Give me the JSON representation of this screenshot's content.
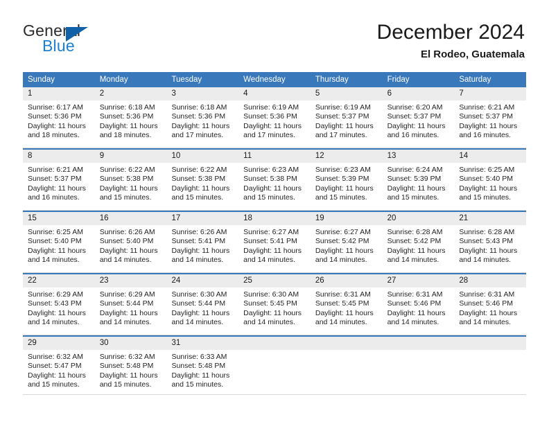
{
  "brand": {
    "word_general": "General",
    "word_blue": "Blue",
    "flag_icon": "brand-flag-icon",
    "accent_color": "#1b7fd4",
    "flag_color": "#1161a8"
  },
  "header": {
    "title": "December 2024",
    "subtitle": "El Rodeo, Guatemala"
  },
  "theme": {
    "header_bar_color": "#3a78bc",
    "daynum_band_color": "#ececec",
    "cell_border_color": "#d8d8d8",
    "text_color": "#1a1a1a"
  },
  "weekdays": [
    "Sunday",
    "Monday",
    "Tuesday",
    "Wednesday",
    "Thursday",
    "Friday",
    "Saturday"
  ],
  "weeks": [
    [
      {
        "day": "1",
        "sunrise": "Sunrise: 6:17 AM",
        "sunset": "Sunset: 5:36 PM",
        "daylight_line1": "Daylight: 11 hours",
        "daylight_line2": "and 18 minutes."
      },
      {
        "day": "2",
        "sunrise": "Sunrise: 6:18 AM",
        "sunset": "Sunset: 5:36 PM",
        "daylight_line1": "Daylight: 11 hours",
        "daylight_line2": "and 18 minutes."
      },
      {
        "day": "3",
        "sunrise": "Sunrise: 6:18 AM",
        "sunset": "Sunset: 5:36 PM",
        "daylight_line1": "Daylight: 11 hours",
        "daylight_line2": "and 17 minutes."
      },
      {
        "day": "4",
        "sunrise": "Sunrise: 6:19 AM",
        "sunset": "Sunset: 5:36 PM",
        "daylight_line1": "Daylight: 11 hours",
        "daylight_line2": "and 17 minutes."
      },
      {
        "day": "5",
        "sunrise": "Sunrise: 6:19 AM",
        "sunset": "Sunset: 5:37 PM",
        "daylight_line1": "Daylight: 11 hours",
        "daylight_line2": "and 17 minutes."
      },
      {
        "day": "6",
        "sunrise": "Sunrise: 6:20 AM",
        "sunset": "Sunset: 5:37 PM",
        "daylight_line1": "Daylight: 11 hours",
        "daylight_line2": "and 16 minutes."
      },
      {
        "day": "7",
        "sunrise": "Sunrise: 6:21 AM",
        "sunset": "Sunset: 5:37 PM",
        "daylight_line1": "Daylight: 11 hours",
        "daylight_line2": "and 16 minutes."
      }
    ],
    [
      {
        "day": "8",
        "sunrise": "Sunrise: 6:21 AM",
        "sunset": "Sunset: 5:37 PM",
        "daylight_line1": "Daylight: 11 hours",
        "daylight_line2": "and 16 minutes."
      },
      {
        "day": "9",
        "sunrise": "Sunrise: 6:22 AM",
        "sunset": "Sunset: 5:38 PM",
        "daylight_line1": "Daylight: 11 hours",
        "daylight_line2": "and 15 minutes."
      },
      {
        "day": "10",
        "sunrise": "Sunrise: 6:22 AM",
        "sunset": "Sunset: 5:38 PM",
        "daylight_line1": "Daylight: 11 hours",
        "daylight_line2": "and 15 minutes."
      },
      {
        "day": "11",
        "sunrise": "Sunrise: 6:23 AM",
        "sunset": "Sunset: 5:38 PM",
        "daylight_line1": "Daylight: 11 hours",
        "daylight_line2": "and 15 minutes."
      },
      {
        "day": "12",
        "sunrise": "Sunrise: 6:23 AM",
        "sunset": "Sunset: 5:39 PM",
        "daylight_line1": "Daylight: 11 hours",
        "daylight_line2": "and 15 minutes."
      },
      {
        "day": "13",
        "sunrise": "Sunrise: 6:24 AM",
        "sunset": "Sunset: 5:39 PM",
        "daylight_line1": "Daylight: 11 hours",
        "daylight_line2": "and 15 minutes."
      },
      {
        "day": "14",
        "sunrise": "Sunrise: 6:25 AM",
        "sunset": "Sunset: 5:40 PM",
        "daylight_line1": "Daylight: 11 hours",
        "daylight_line2": "and 15 minutes."
      }
    ],
    [
      {
        "day": "15",
        "sunrise": "Sunrise: 6:25 AM",
        "sunset": "Sunset: 5:40 PM",
        "daylight_line1": "Daylight: 11 hours",
        "daylight_line2": "and 14 minutes."
      },
      {
        "day": "16",
        "sunrise": "Sunrise: 6:26 AM",
        "sunset": "Sunset: 5:40 PM",
        "daylight_line1": "Daylight: 11 hours",
        "daylight_line2": "and 14 minutes."
      },
      {
        "day": "17",
        "sunrise": "Sunrise: 6:26 AM",
        "sunset": "Sunset: 5:41 PM",
        "daylight_line1": "Daylight: 11 hours",
        "daylight_line2": "and 14 minutes."
      },
      {
        "day": "18",
        "sunrise": "Sunrise: 6:27 AM",
        "sunset": "Sunset: 5:41 PM",
        "daylight_line1": "Daylight: 11 hours",
        "daylight_line2": "and 14 minutes."
      },
      {
        "day": "19",
        "sunrise": "Sunrise: 6:27 AM",
        "sunset": "Sunset: 5:42 PM",
        "daylight_line1": "Daylight: 11 hours",
        "daylight_line2": "and 14 minutes."
      },
      {
        "day": "20",
        "sunrise": "Sunrise: 6:28 AM",
        "sunset": "Sunset: 5:42 PM",
        "daylight_line1": "Daylight: 11 hours",
        "daylight_line2": "and 14 minutes."
      },
      {
        "day": "21",
        "sunrise": "Sunrise: 6:28 AM",
        "sunset": "Sunset: 5:43 PM",
        "daylight_line1": "Daylight: 11 hours",
        "daylight_line2": "and 14 minutes."
      }
    ],
    [
      {
        "day": "22",
        "sunrise": "Sunrise: 6:29 AM",
        "sunset": "Sunset: 5:43 PM",
        "daylight_line1": "Daylight: 11 hours",
        "daylight_line2": "and 14 minutes."
      },
      {
        "day": "23",
        "sunrise": "Sunrise: 6:29 AM",
        "sunset": "Sunset: 5:44 PM",
        "daylight_line1": "Daylight: 11 hours",
        "daylight_line2": "and 14 minutes."
      },
      {
        "day": "24",
        "sunrise": "Sunrise: 6:30 AM",
        "sunset": "Sunset: 5:44 PM",
        "daylight_line1": "Daylight: 11 hours",
        "daylight_line2": "and 14 minutes."
      },
      {
        "day": "25",
        "sunrise": "Sunrise: 6:30 AM",
        "sunset": "Sunset: 5:45 PM",
        "daylight_line1": "Daylight: 11 hours",
        "daylight_line2": "and 14 minutes."
      },
      {
        "day": "26",
        "sunrise": "Sunrise: 6:31 AM",
        "sunset": "Sunset: 5:45 PM",
        "daylight_line1": "Daylight: 11 hours",
        "daylight_line2": "and 14 minutes."
      },
      {
        "day": "27",
        "sunrise": "Sunrise: 6:31 AM",
        "sunset": "Sunset: 5:46 PM",
        "daylight_line1": "Daylight: 11 hours",
        "daylight_line2": "and 14 minutes."
      },
      {
        "day": "28",
        "sunrise": "Sunrise: 6:31 AM",
        "sunset": "Sunset: 5:46 PM",
        "daylight_line1": "Daylight: 11 hours",
        "daylight_line2": "and 14 minutes."
      }
    ],
    [
      {
        "day": "29",
        "sunrise": "Sunrise: 6:32 AM",
        "sunset": "Sunset: 5:47 PM",
        "daylight_line1": "Daylight: 11 hours",
        "daylight_line2": "and 15 minutes."
      },
      {
        "day": "30",
        "sunrise": "Sunrise: 6:32 AM",
        "sunset": "Sunset: 5:48 PM",
        "daylight_line1": "Daylight: 11 hours",
        "daylight_line2": "and 15 minutes."
      },
      {
        "day": "31",
        "sunrise": "Sunrise: 6:33 AM",
        "sunset": "Sunset: 5:48 PM",
        "daylight_line1": "Daylight: 11 hours",
        "daylight_line2": "and 15 minutes."
      },
      {
        "day": "",
        "sunrise": "",
        "sunset": "",
        "daylight_line1": "",
        "daylight_line2": ""
      },
      {
        "day": "",
        "sunrise": "",
        "sunset": "",
        "daylight_line1": "",
        "daylight_line2": ""
      },
      {
        "day": "",
        "sunrise": "",
        "sunset": "",
        "daylight_line1": "",
        "daylight_line2": ""
      },
      {
        "day": "",
        "sunrise": "",
        "sunset": "",
        "daylight_line1": "",
        "daylight_line2": ""
      }
    ]
  ]
}
